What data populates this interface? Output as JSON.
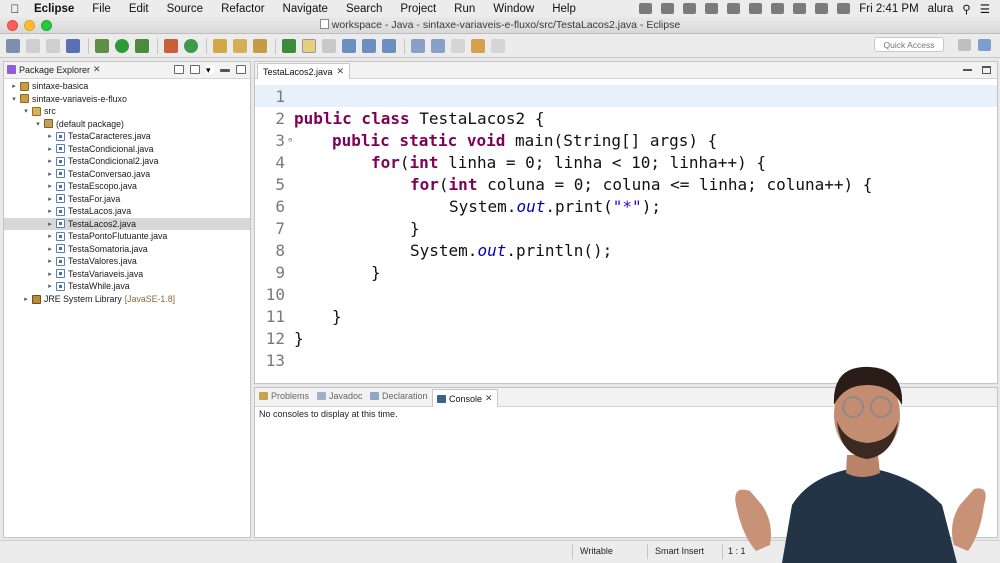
{
  "menubar": {
    "app_name": "Eclipse",
    "items": [
      "File",
      "Edit",
      "Source",
      "Refactor",
      "Navigate",
      "Search",
      "Project",
      "Run",
      "Window",
      "Help"
    ],
    "clock": "Fri 2:41 PM",
    "user": "alura"
  },
  "window": {
    "title": "workspace - Java - sintaxe-variaveis-e-fluxo/src/TestaLacos2.java - Eclipse"
  },
  "toolbar": {
    "quick_access_placeholder": "Quick Access"
  },
  "package_explorer": {
    "tab_label": "Package Explorer",
    "projects": [
      {
        "name": "sintaxe-basica"
      },
      {
        "name": "sintaxe-variaveis-e-fluxo"
      }
    ],
    "src_label": "src",
    "package_label": "(default package)",
    "files": [
      "TestaCaracteres.java",
      "TestaCondicional.java",
      "TestaCondicional2.java",
      "TestaConversao.java",
      "TestaEscopo.java",
      "TestaFor.java",
      "TestaLacos.java",
      "TestaLacos2.java",
      "TestaPontoFlutuante.java",
      "TestaSomatoria.java",
      "TestaValores.java",
      "TestaVariaveis.java",
      "TestaWhile.java"
    ],
    "selected_file": "TestaLacos2.java",
    "library": {
      "name": "JRE System Library",
      "version": "[JavaSE-1.8]"
    }
  },
  "editor": {
    "tab_label": "TestaLacos2.java",
    "line_numbers": [
      "1",
      "2",
      "3",
      "4",
      "5",
      "6",
      "7",
      "8",
      "9",
      "10",
      "11",
      "12",
      "13"
    ],
    "code": {
      "l2_kw": "public class",
      "l2_rest": " TestaLacos2 {",
      "l3_kw": "public static void",
      "l3_rest": " main(String[] args) {",
      "l4_kw1": "for",
      "l4_a": "(",
      "l4_kw2": "int",
      "l4_rest": " linha = 0; linha < 10; linha++) {",
      "l5_kw1": "for",
      "l5_a": "(",
      "l5_kw2": "int",
      "l5_rest": " coluna = 0; coluna <= linha; coluna++) {",
      "l6_a": "System.",
      "l6_field": "out",
      "l6_b": ".print(",
      "l6_str": "\"*\"",
      "l6_c": ");",
      "l7": "}",
      "l8_a": "System.",
      "l8_field": "out",
      "l8_b": ".println();",
      "l9": "}",
      "l11": "}",
      "l12": "}"
    }
  },
  "bottom_panel": {
    "tabs": [
      "Problems",
      "Javadoc",
      "Declaration",
      "Console"
    ],
    "active_tab": "Console",
    "console_message": "No consoles to display at this time."
  },
  "statusbar": {
    "writable": "Writable",
    "insert_mode": "Smart Insert",
    "position": "1 : 1"
  },
  "colors": {
    "keyword": "#7f0055",
    "string": "#2a00ff",
    "static_field": "#0000c0",
    "current_line": "#e8f0fb",
    "selection": "#d8d8d8"
  }
}
